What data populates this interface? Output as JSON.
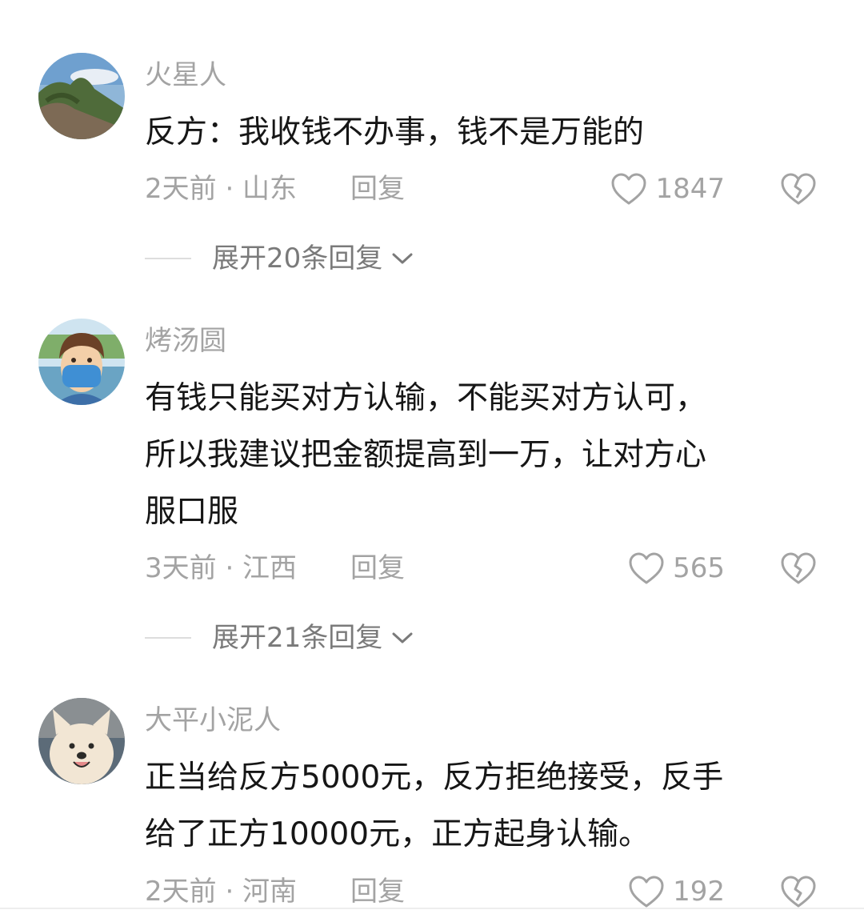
{
  "comments": [
    {
      "username": "火星人",
      "lines": [
        "反方：我收钱不办事，钱不是万能的"
      ],
      "meta": "2天前 · 山东",
      "reply_label": "回复",
      "likes": "1847",
      "expand_label": "展开20条回复"
    },
    {
      "username": "烤汤圆",
      "lines": [
        "有钱只能买对方认输，不能买对方认可，",
        "所以我建议把金额提高到一万，让对方心",
        "服口服"
      ],
      "meta": "3天前 · 江西",
      "reply_label": "回复",
      "likes": "565",
      "expand_label": "展开21条回复"
    },
    {
      "username": "大平小泥人",
      "lines": [
        "正当给反方5000元，反方拒绝接受，反手",
        "给了正方10000元，正方起身认输。"
      ],
      "meta": "2天前 · 河南",
      "reply_label": "回复",
      "likes": "192"
    }
  ],
  "icons": {
    "like": "heart-outline-icon",
    "dislike": "broken-heart-icon",
    "expand": "chevron-down-icon"
  },
  "colors": {
    "text": "#161616",
    "muted": "#a3a3a3",
    "expand_text": "#7a7a7a"
  }
}
